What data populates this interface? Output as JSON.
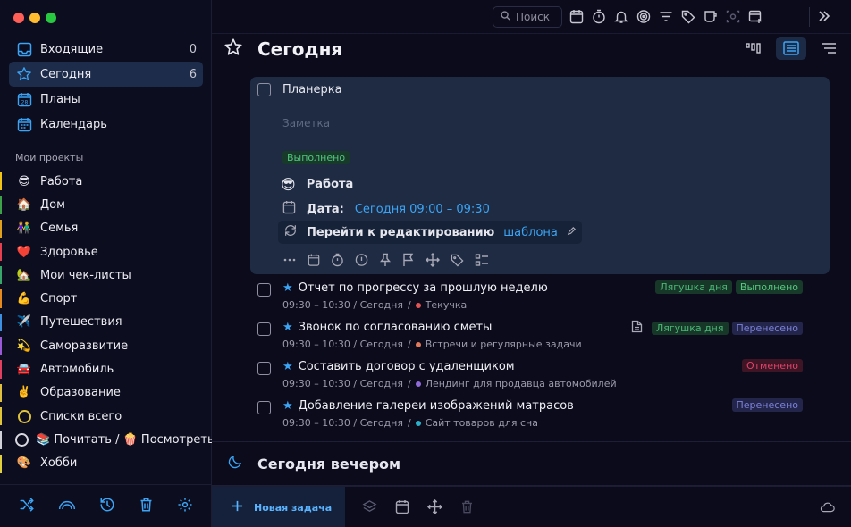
{
  "sidebar": {
    "nav": [
      {
        "label": "Входящие",
        "count": "0",
        "icon": "inbox-icon"
      },
      {
        "label": "Сегодня",
        "count": "6",
        "icon": "star-icon"
      },
      {
        "label": "Планы",
        "count": "",
        "icon": "calendar-28-icon"
      },
      {
        "label": "Календарь",
        "count": "",
        "icon": "calendar-icon"
      }
    ],
    "projects_title": "Мои проекты",
    "projects": [
      {
        "emoji": "😎",
        "label": "Работа",
        "color": "#f0c419"
      },
      {
        "emoji": "🏠",
        "label": "Дом",
        "color": "#3fa24b"
      },
      {
        "emoji": "👫",
        "label": "Семья",
        "color": "#e0a020"
      },
      {
        "emoji": "❤️",
        "label": "Здоровье",
        "color": "#e54050"
      },
      {
        "emoji": "🏡",
        "label": "Мои чек-листы",
        "color": "#3aa56a"
      },
      {
        "emoji": "💪",
        "label": "Спорт",
        "color": "#e58a20"
      },
      {
        "emoji": "✈️",
        "label": "Путешествия",
        "color": "#3f8fe0"
      },
      {
        "emoji": "💫",
        "label": "Саморазвитие",
        "color": "#9a5ad8"
      },
      {
        "emoji": "🚘",
        "label": "Автомобиль",
        "color": "#e04060"
      },
      {
        "emoji": "✌️",
        "label": "Образование",
        "color": "#e0c040"
      },
      {
        "emoji": "",
        "label": "Списки всего",
        "color": "#e0c43a",
        "ring": "yellow"
      },
      {
        "emoji": "",
        "label": "📚 Почитать / 🍿 Посмотреть",
        "color": "#d0d0d8",
        "ring": "white"
      },
      {
        "emoji": "🎨",
        "label": "Хобби",
        "color": "#e0d040"
      }
    ]
  },
  "topbar": {
    "search_placeholder": "Поиск"
  },
  "main": {
    "title": "Сегодня",
    "expanded_task": {
      "title": "Планерка",
      "note_placeholder": "Заметка",
      "tag": "Выполнено",
      "project": "Работа",
      "project_emoji": "😎",
      "date_label": "Дата:",
      "date_value": "Сегодня 09:00 – 09:30",
      "template_text": "Перейти к редактированию",
      "template_link": "шаблона"
    },
    "tasks": [
      {
        "title": "Отчет по прогрессу за прошлую неделю",
        "time": "09:30 – 10:30 / Сегодня",
        "project": "Текучка",
        "dot": "#e25555",
        "tags": [
          {
            "label": "Лягушка дня",
            "kind": "frog"
          },
          {
            "label": "Выполнено",
            "kind": "done"
          }
        ],
        "note": false
      },
      {
        "title": "Звонок по согласованию сметы",
        "time": "09:30 – 10:30 / Сегодня",
        "project": "Встречи и регулярные задачи",
        "dot": "#e07a5a",
        "tags": [
          {
            "label": "Лягушка дня",
            "kind": "frog"
          },
          {
            "label": "Перенесено",
            "kind": "moved"
          }
        ],
        "note": true
      },
      {
        "title": "Составить договор с удаленщиком",
        "time": "09:30 – 10:30 / Сегодня",
        "project": "Лендинг для продавца автомобилей",
        "dot": "#8f6ad8",
        "tags": [
          {
            "label": "Отменено",
            "kind": "cancel"
          }
        ],
        "note": false
      },
      {
        "title": "Добавление галереи изображений матрасов",
        "time": "09:30 – 10:30 / Сегодня",
        "project": "Сайт товаров для сна",
        "dot": "#2ab0c8",
        "tags": [
          {
            "label": "Перенесено",
            "kind": "moved"
          }
        ],
        "note": false
      }
    ],
    "evening_title": "Сегодня вечером"
  },
  "bottombar": {
    "new_task": "Новая задача"
  }
}
